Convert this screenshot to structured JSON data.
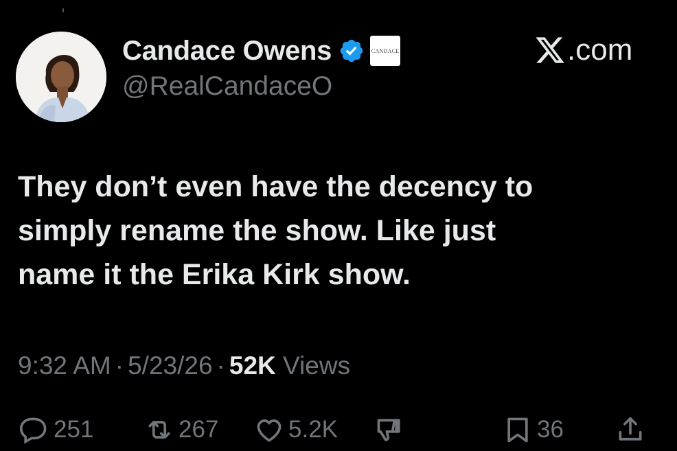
{
  "author": {
    "display_name": "Candace Owens",
    "handle": "@RealCandaceO",
    "affiliate_badge_text": "CANDACE",
    "verified_color": "#1d9bf0"
  },
  "brand": {
    "text": ".com"
  },
  "tweet": {
    "lines": [
      "They don’t even have the decency to",
      "simply rename the show. Like just",
      "name it the Erika Kirk show."
    ]
  },
  "meta": {
    "time": "9:32 AM",
    "separator": "·",
    "date": "5/23/26",
    "views_count": "52K",
    "views_label": "Views"
  },
  "actions": {
    "replies": "251",
    "reposts": "267",
    "likes": "5.2K",
    "bookmarks": "36"
  },
  "icons": {
    "reply": "reply-icon",
    "repost": "repost-icon",
    "like": "heart-icon",
    "dislike": "thumbs-down-icon",
    "bookmark": "bookmark-icon",
    "share": "share-icon"
  }
}
